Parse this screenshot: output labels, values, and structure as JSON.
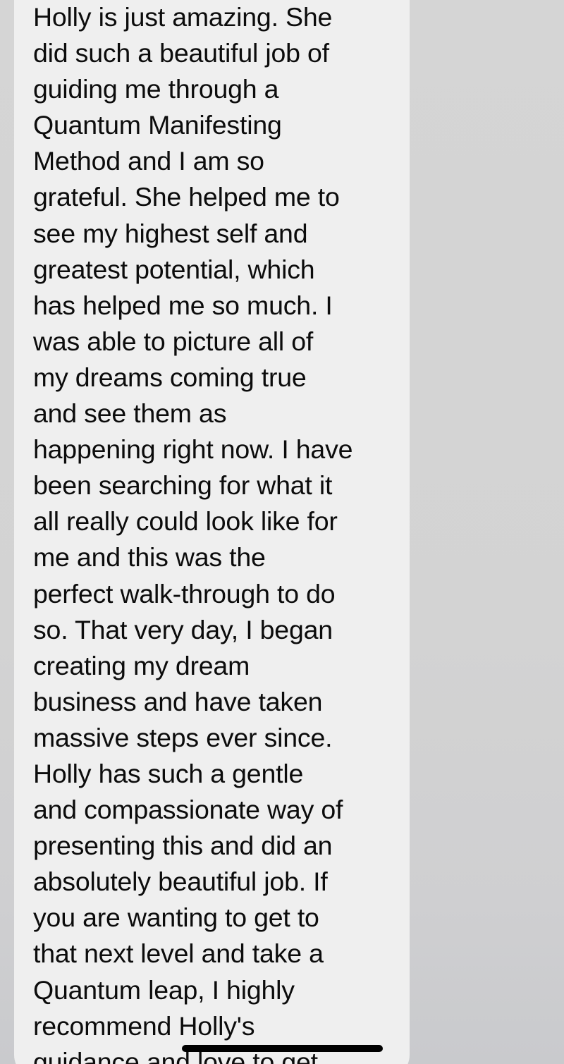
{
  "message": {
    "lines": [
      "Holly is just amazing. She",
      "did such a beautiful job of",
      "guiding me through a",
      "Quantum Manifesting",
      "Method and I am so",
      "grateful. She helped me to",
      "see my highest self and",
      "greatest potential, which",
      "has helped me so much. I",
      "was able to picture all of",
      "my dreams coming true",
      "and see them as",
      "happening right now. I have",
      "been searching for what it",
      "all really could look like for",
      "me and this was the",
      "perfect walk-through to do",
      "so. That very day, I began",
      "creating my dream",
      "business and have taken",
      "massive steps ever since.",
      "Holly has such a gentle",
      "and compassionate way of",
      "presenting this and did an",
      "absolutely beautiful job. If",
      "you are wanting to get to",
      "that next level and take a",
      "Quantum leap, I highly",
      "recommend Holly's",
      "guidance and love to get"
    ]
  },
  "colors": {
    "background": "#d4d4d4",
    "bubble": "#efefef",
    "text": "#0c0c0c",
    "home_indicator": "#000000"
  }
}
